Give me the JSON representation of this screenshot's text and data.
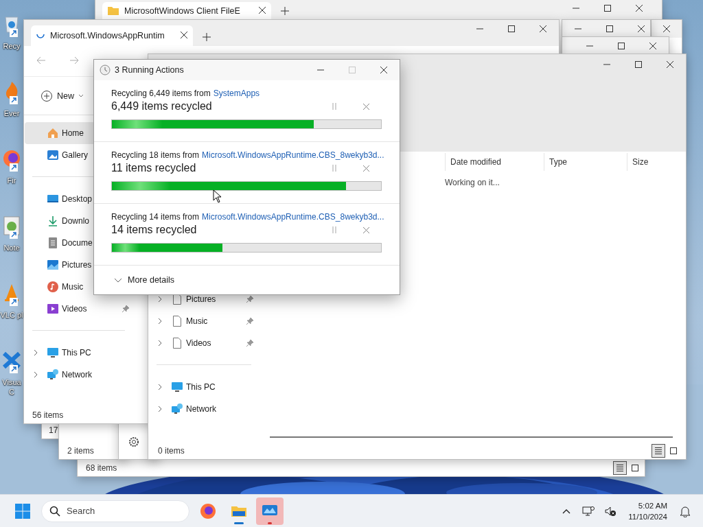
{
  "desktop_icons": [
    {
      "label": "Recy",
      "kind": "bin"
    },
    {
      "label": "Ever",
      "kind": "flame"
    },
    {
      "label": "Fir",
      "kind": "fox"
    },
    {
      "label": "Note",
      "kind": "notepad"
    },
    {
      "label": "VLC pl",
      "kind": "cone"
    },
    {
      "label": "Visua C",
      "kind": "cross"
    }
  ],
  "background_windows": [
    {
      "status": "17"
    },
    {
      "tab": "MicrosoftWindows Client FileE"
    },
    {
      "status": "68 items",
      "views": [
        {
          "kind": "details",
          "selected": true
        },
        {
          "kind": "tiles",
          "selected": false
        }
      ]
    },
    {
      "status": "2 items"
    }
  ],
  "explorer": {
    "tab": "Microsoft.WindowsAppRuntim",
    "new_button": "New",
    "nav_groups": [
      [
        {
          "label": "Home",
          "kind": "home",
          "selected": true
        },
        {
          "label": "Gallery",
          "kind": "gallery",
          "selected": false
        }
      ],
      [
        {
          "label": "Desktop",
          "kind": "desktop",
          "selected": false
        },
        {
          "label": "Downlo",
          "kind": "downloads",
          "selected": false
        },
        {
          "label": "Docume",
          "kind": "documents",
          "selected": false
        },
        {
          "label": "Pictures",
          "kind": "pictures",
          "selected": false
        },
        {
          "label": "Music",
          "kind": "music",
          "selected": false
        },
        {
          "label": "Videos",
          "kind": "videos",
          "selected": false,
          "pinned": true
        }
      ],
      [
        {
          "label": "This PC",
          "kind": "pc",
          "selected": false,
          "expanded": false
        },
        {
          "label": "Network",
          "kind": "network",
          "selected": false,
          "expanded": false
        }
      ]
    ],
    "status": "56 items"
  },
  "front_explorer": {
    "columns": [
      "Date modified",
      "Type",
      "Size"
    ],
    "message": "Working on it...",
    "nav_groups": [
      [
        {
          "label": "Pictures",
          "kind": "file",
          "pinned": true,
          "expanded": false
        },
        {
          "label": "Music",
          "kind": "file",
          "pinned": true,
          "expanded": false
        },
        {
          "label": "Videos",
          "kind": "file",
          "pinned": true,
          "expanded": false
        }
      ],
      [
        {
          "label": "This PC",
          "kind": "pc",
          "expanded": false
        },
        {
          "label": "Network",
          "kind": "network",
          "expanded": false
        }
      ]
    ],
    "status": "0 items",
    "views": [
      {
        "kind": "details",
        "selected": true
      },
      {
        "kind": "tiles",
        "selected": false
      }
    ]
  },
  "dialog": {
    "title": "3 Running Actions",
    "operations": [
      {
        "description": "Recycling 6,449 items from",
        "source": "SystemApps",
        "progress_text": "6,449 items recycled",
        "level": 0.75
      },
      {
        "description": "Recycling 18 items from",
        "source": "Microsoft.WindowsAppRuntime.CBS_8wekyb3d...",
        "progress_text": "11 items recycled",
        "level": 0.87
      },
      {
        "description": "Recycling 14 items from",
        "source": "Microsoft.WindowsAppRuntime.CBS_8wekyb3d...",
        "progress_text": "14 items recycled",
        "level": 0.41
      }
    ],
    "more_details": "More details"
  },
  "taskbar": {
    "search_placeholder": "Search",
    "apps": [
      {
        "kind": "browser",
        "running": false,
        "selected": false
      },
      {
        "kind": "folder",
        "running": true,
        "selected": false
      },
      {
        "kind": "monitor",
        "running": true,
        "selected": true
      }
    ],
    "time": "5:02 AM",
    "date": "11/10/2024"
  }
}
